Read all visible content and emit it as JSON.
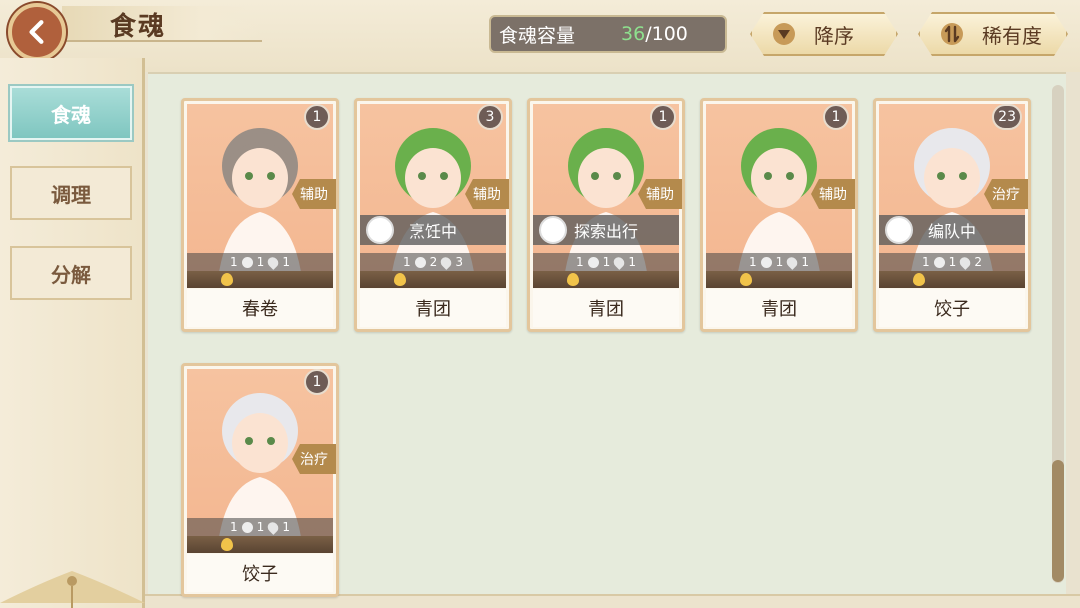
{
  "header": {
    "title": "食魂",
    "capacity_label": "食魂容量",
    "capacity_current": "36",
    "capacity_max": "/100",
    "sort_desc_label": "降序",
    "sort_rarity_label": "稀有度"
  },
  "sidebar": {
    "tabs": [
      {
        "label": "食魂",
        "active": true
      },
      {
        "label": "调理",
        "active": false
      },
      {
        "label": "分解",
        "active": false
      }
    ]
  },
  "cards": [
    {
      "name": "春卷",
      "count": "1",
      "role": "辅助",
      "status": "",
      "stat_a": "1",
      "stat_b": "1",
      "stat_c": "1",
      "hair": "#9b8f86"
    },
    {
      "name": "青团",
      "count": "3",
      "role": "辅助",
      "status": "烹饪中",
      "stat_a": "1",
      "stat_b": "2",
      "stat_c": "3",
      "hair": "#6ab04c"
    },
    {
      "name": "青团",
      "count": "1",
      "role": "辅助",
      "status": "探索出行",
      "stat_a": "1",
      "stat_b": "1",
      "stat_c": "1",
      "hair": "#6ab04c"
    },
    {
      "name": "青团",
      "count": "1",
      "role": "辅助",
      "status": "",
      "stat_a": "1",
      "stat_b": "1",
      "stat_c": "1",
      "hair": "#6ab04c"
    },
    {
      "name": "饺子",
      "count": "23",
      "role": "治疗",
      "status": "编队中",
      "stat_a": "1",
      "stat_b": "1",
      "stat_c": "2",
      "hair": "#e8e8ec"
    },
    {
      "name": "饺子",
      "count": "1",
      "role": "治疗",
      "status": "",
      "stat_a": "1",
      "stat_b": "1",
      "stat_c": "1",
      "hair": "#e8e8ec"
    }
  ]
}
